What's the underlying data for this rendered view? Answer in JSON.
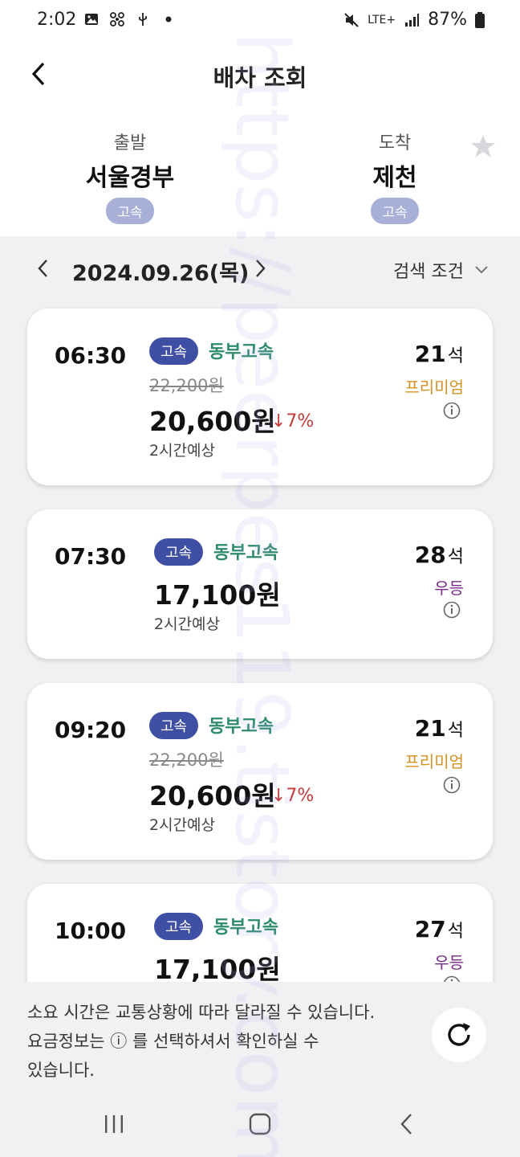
{
  "statusbar": {
    "time": "2:02",
    "network": "LTE+",
    "battery": "87%"
  },
  "header": {
    "title": "배차 조회"
  },
  "route": {
    "departure_label": "출발",
    "departure_station": "서울경부",
    "departure_badge": "고속",
    "arrival_label": "도착",
    "arrival_station": "제천",
    "arrival_badge": "고속"
  },
  "datebar": {
    "date": "2024.09.26(목)",
    "filter_label": "검색 조건"
  },
  "results": [
    {
      "time": "06:30",
      "grade": "고속",
      "company": "동부고속",
      "original_price": "22,200원",
      "price": "20,600원",
      "discount": "↓7%",
      "duration": "2시간예상",
      "seats": "21",
      "seats_unit": "석",
      "seat_grade": "프리미엄"
    },
    {
      "time": "07:30",
      "grade": "고속",
      "company": "동부고속",
      "original_price": "",
      "price": "17,100원",
      "discount": "",
      "duration": "2시간예상",
      "seats": "28",
      "seats_unit": "석",
      "seat_grade": "우등"
    },
    {
      "time": "09:20",
      "grade": "고속",
      "company": "동부고속",
      "original_price": "22,200원",
      "price": "20,600원",
      "discount": "↓7%",
      "duration": "2시간예상",
      "seats": "21",
      "seats_unit": "석",
      "seat_grade": "프리미엄"
    },
    {
      "time": "10:00",
      "grade": "고속",
      "company": "동부고속",
      "original_price": "",
      "price": "17,100원",
      "discount": "",
      "duration": "",
      "seats": "27",
      "seats_unit": "석",
      "seat_grade": "우등"
    }
  ],
  "footer": {
    "notice_line1": "소요 시간은 교통상황에 따라 달라질 수 있습니다.",
    "notice_line2": "요금정보는 ⓘ 를 선택하셔서 확인하실 수",
    "notice_line3": "있습니다."
  },
  "watermark": "https://peerpes119.tistory.com/",
  "colors": {
    "grade_badge": "#3f4fa4",
    "company": "#2d8a6e",
    "premium": "#d79022",
    "udeung": "#7a2b8a",
    "discount": "#c43a3a"
  }
}
